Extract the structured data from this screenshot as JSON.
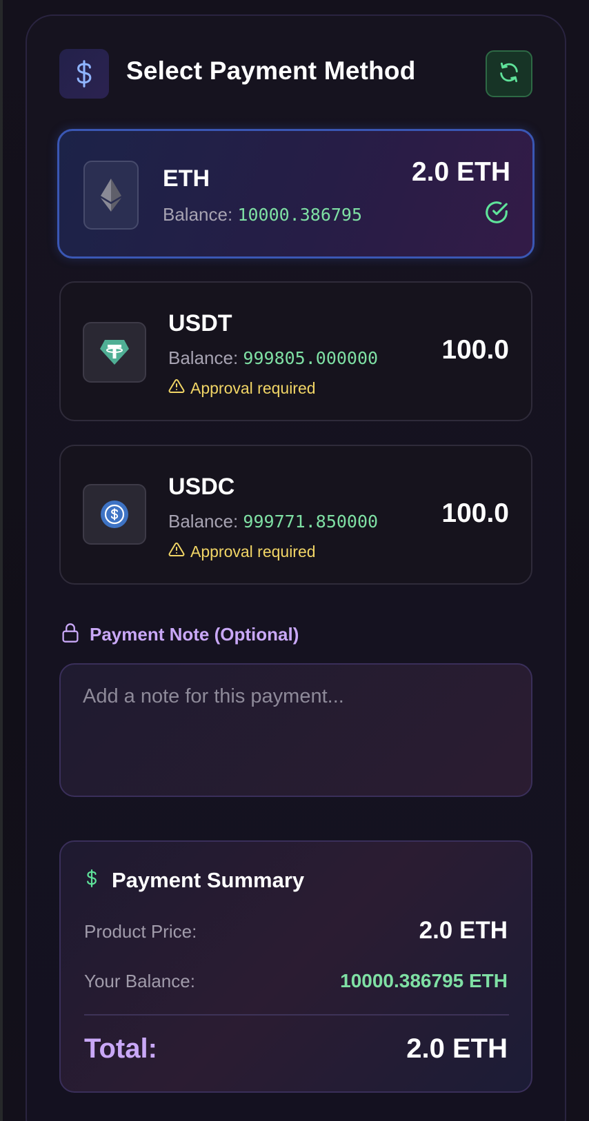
{
  "header": {
    "title": "Select Payment Method",
    "icon": "dollar-icon",
    "refresh_icon": "refresh-icon"
  },
  "methods": [
    {
      "symbol": "ETH",
      "icon": "ethereum-icon",
      "balance_label": "Balance:",
      "balance_value": "10000.386795",
      "amount": "2.0 ETH",
      "selected": true,
      "status_icon": "check-circle-icon"
    },
    {
      "symbol": "USDT",
      "icon": "tether-icon",
      "balance_label": "Balance:",
      "balance_value": "999805.000000",
      "amount": "100.0",
      "approval": "Approval required"
    },
    {
      "symbol": "USDC",
      "icon": "usdc-icon",
      "balance_label": "Balance:",
      "balance_value": "999771.850000",
      "amount": "100.0",
      "approval": "Approval required"
    }
  ],
  "note": {
    "label": "Payment Note (Optional)",
    "icon": "lock-icon",
    "placeholder": "Add a note for this payment...",
    "value": ""
  },
  "summary": {
    "title": "Payment Summary",
    "icon": "dollar-icon",
    "product_price_label": "Product Price:",
    "product_price_value": "2.0 ETH",
    "balance_label": "Your Balance:",
    "balance_value": "10000.386795 ETH",
    "total_label": "Total:",
    "total_value": "2.0 ETH"
  },
  "colors": {
    "accent_purple": "#c9a8f7",
    "balance_green": "#7fe0a4",
    "warning_yellow": "#f2d666",
    "selected_border": "#3a57b4",
    "refresh_green": "#5fe39a"
  }
}
